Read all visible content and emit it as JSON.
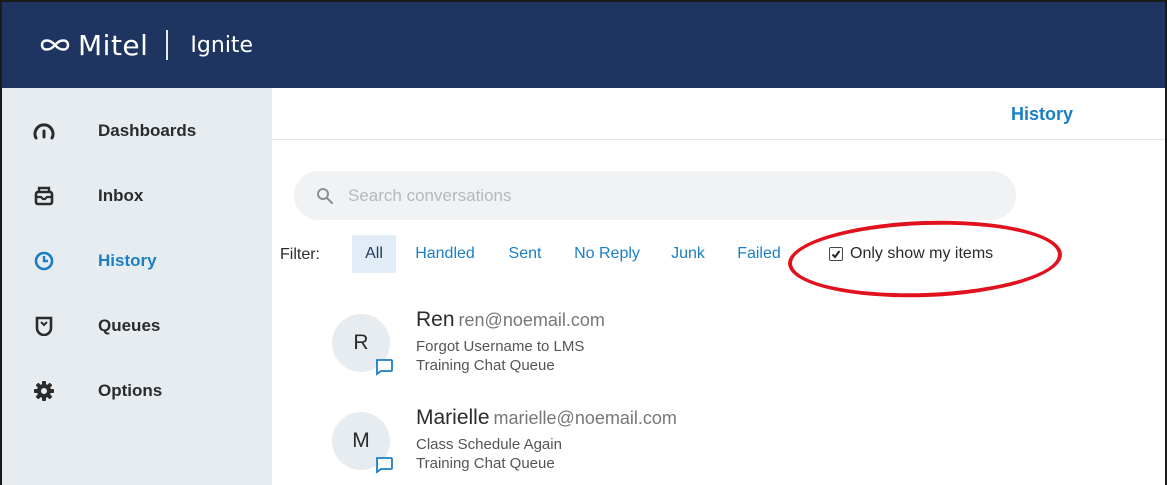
{
  "app": {
    "brand": "Mitel",
    "product": "Ignite"
  },
  "sidebar": {
    "items": [
      {
        "label": "Dashboards",
        "icon": "gauge-icon",
        "active": false
      },
      {
        "label": "Inbox",
        "icon": "inbox-icon",
        "active": false
      },
      {
        "label": "History",
        "icon": "clock-icon",
        "active": true
      },
      {
        "label": "Queues",
        "icon": "queue-icon",
        "active": false
      },
      {
        "label": "Options",
        "icon": "gear-icon",
        "active": false
      }
    ]
  },
  "main": {
    "title": "History",
    "search": {
      "placeholder": "Search conversations",
      "value": ""
    },
    "filter": {
      "label": "Filter:",
      "options": [
        "All",
        "Handled",
        "Sent",
        "No Reply",
        "Junk",
        "Failed"
      ],
      "selected": "All",
      "only_mine_label": "Only show my items",
      "only_mine_checked": true
    },
    "conversations": [
      {
        "initial": "R",
        "name": "Ren",
        "email": "ren@noemail.com",
        "subject": "Forgot Username to LMS",
        "queue": "Training Chat Queue",
        "channel_icon": "chat-icon"
      },
      {
        "initial": "M",
        "name": "Marielle",
        "email": "marielle@noemail.com",
        "subject": "Class Schedule Again",
        "queue": "Training Chat Queue",
        "channel_icon": "chat-icon"
      }
    ]
  },
  "colors": {
    "topbar": "#1d3560",
    "sidebar": "#e7ecf1",
    "accent": "#1a7fc4",
    "annotation": "#e1121d"
  }
}
